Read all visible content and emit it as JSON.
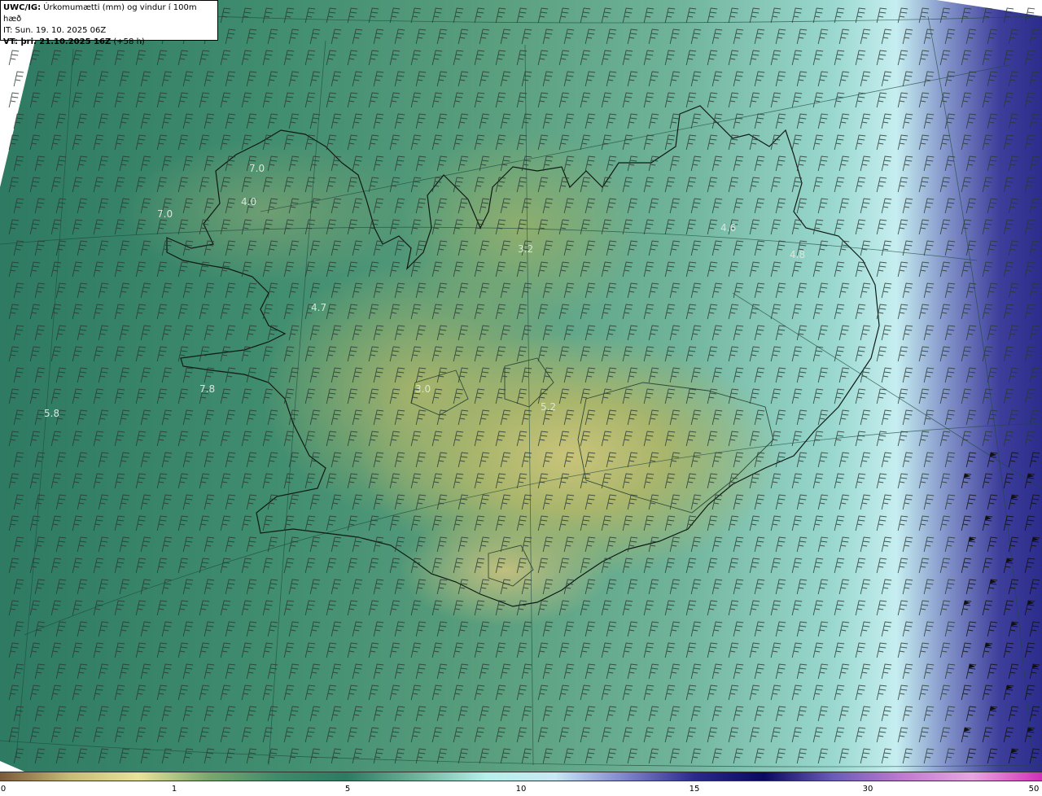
{
  "header": {
    "title_prefix": "UWC/IG:",
    "title_text": "Úrkomumætti (mm) og vindur í 100m hæð",
    "initial_time": "IT: Sun. 19. 10. 2025 06Z",
    "valid_prefix": "VT: þri. 21.10.2025 16Z",
    "valid_suffix": "(+58 h)"
  },
  "value_labels": [
    {
      "text": "7.0"
    },
    {
      "text": "4.0"
    },
    {
      "text": "7.0"
    },
    {
      "text": "4.7"
    },
    {
      "text": "7.8"
    },
    {
      "text": "5.8"
    },
    {
      "text": "3.2"
    },
    {
      "text": "3.0"
    },
    {
      "text": "5.2"
    },
    {
      "text": "4.6"
    },
    {
      "text": "4.8"
    }
  ],
  "colorbar": {
    "ticks": [
      "0",
      "1",
      "5",
      "10",
      "15",
      "30",
      "50"
    ],
    "colors": [
      "#7a5a3a",
      "#c8bb77",
      "#e8e29a",
      "#7aa86e",
      "#3f8a6a",
      "#2e7a62",
      "#6fb39a",
      "#b6f0ea",
      "#c9e7f5",
      "#7f84cc",
      "#2a2a8a",
      "#0a0a60",
      "#6a5cb8",
      "#c07ad0",
      "#e8a6e0",
      "#d030b8"
    ]
  },
  "wind": {
    "symbol": "wind-barb"
  }
}
